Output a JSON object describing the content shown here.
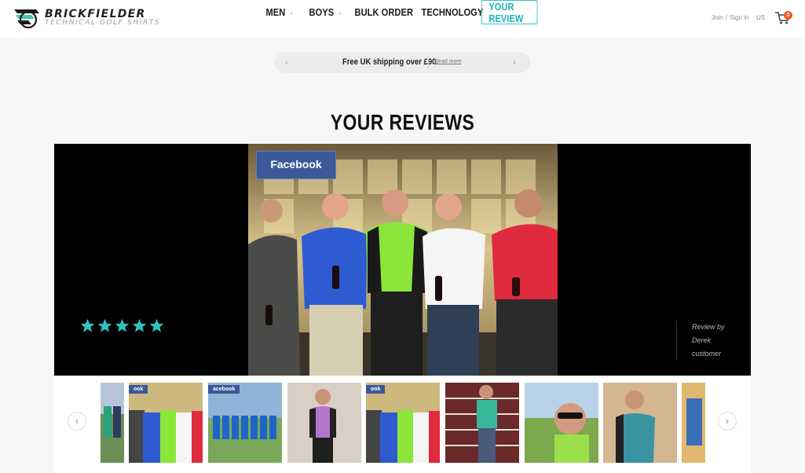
{
  "brand": {
    "name": "BRICKFIELDER",
    "tagline": "TECHNICAL GOLF SHIRTS"
  },
  "nav": {
    "items": [
      {
        "label": "MEN",
        "has_dropdown": true
      },
      {
        "label": "BOYS",
        "has_dropdown": true
      },
      {
        "label": "BULK ORDER",
        "has_dropdown": false
      },
      {
        "label": "TECHNOLOGY",
        "has_dropdown": false
      },
      {
        "label": "YOUR REVIEW",
        "has_dropdown": false,
        "active": true
      }
    ]
  },
  "account": {
    "join": "Join",
    "separator": "/",
    "signin": "Sign in",
    "region": "US",
    "cart_count": "0"
  },
  "promo": {
    "text": "Free UK shipping over £90.",
    "link": "Read more",
    "prev": "‹",
    "next": "›"
  },
  "page": {
    "title": "YOUR REVIEWS"
  },
  "review": {
    "badge": "Facebook",
    "rating": 5,
    "max_rating": 5,
    "byline": [
      "Review by",
      "Derek",
      "customer"
    ]
  },
  "thumbs": {
    "prev": "‹",
    "next": "›",
    "mini_badge": "acebook",
    "mini_badge_small": "ook"
  },
  "colors": {
    "accent": "#33c5c5",
    "star": "#2ec4c4",
    "cart_badge": "#f05a22",
    "facebook": "#3b5998"
  }
}
